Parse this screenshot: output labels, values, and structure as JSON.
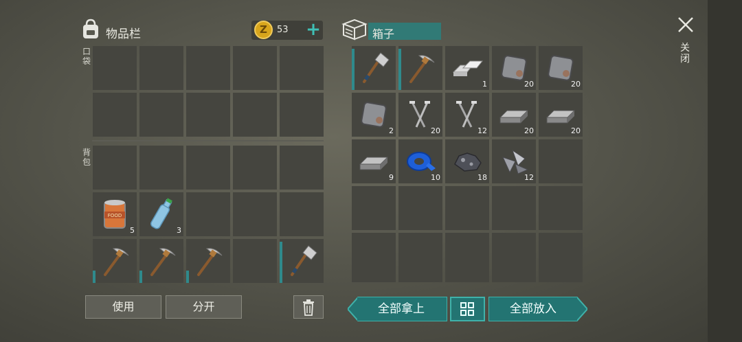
{
  "inventory": {
    "title": "物品栏",
    "coins": "53",
    "pocket_label": "口袋",
    "backpack_label": "背包",
    "pocket_items": [],
    "backpack_items": [
      {
        "slot": 5,
        "icon": "food-can-icon",
        "count": "5"
      },
      {
        "slot": 6,
        "icon": "water-bottle-icon",
        "count": "3"
      },
      {
        "slot": 10,
        "icon": "pickaxe-icon",
        "count": ""
      },
      {
        "slot": 11,
        "icon": "pickaxe-icon",
        "count": ""
      },
      {
        "slot": 12,
        "icon": "pickaxe-icon",
        "count": ""
      },
      {
        "slot": 14,
        "icon": "hatchet-icon",
        "count": ""
      }
    ],
    "use_button": "使用",
    "split_button": "分开"
  },
  "box": {
    "title": "箱子",
    "items": [
      {
        "slot": 0,
        "icon": "hatchet-icon",
        "count": ""
      },
      {
        "slot": 1,
        "icon": "pickaxe-icon",
        "count": ""
      },
      {
        "slot": 2,
        "icon": "aluminum-ingot-icon",
        "count": "1"
      },
      {
        "slot": 3,
        "icon": "iron-plate-icon",
        "count": "20"
      },
      {
        "slot": 4,
        "icon": "iron-plate-icon",
        "count": "20"
      },
      {
        "slot": 5,
        "icon": "iron-plate-icon",
        "count": "2"
      },
      {
        "slot": 6,
        "icon": "nails-icon",
        "count": "20"
      },
      {
        "slot": 7,
        "icon": "nails-icon",
        "count": "12"
      },
      {
        "slot": 8,
        "icon": "iron-bar-icon",
        "count": "20"
      },
      {
        "slot": 9,
        "icon": "iron-bar-icon",
        "count": "20"
      },
      {
        "slot": 10,
        "icon": "iron-bar-icon",
        "count": "9"
      },
      {
        "slot": 11,
        "icon": "tape-icon",
        "count": "10"
      },
      {
        "slot": 12,
        "icon": "iron-ore-icon",
        "count": "18"
      },
      {
        "slot": 13,
        "icon": "scrap-metal-icon",
        "count": "12"
      }
    ],
    "take_all_button": "全部拿上",
    "put_all_button": "全部放入"
  },
  "close_label": "关闭",
  "colors": {
    "accent": "#2f8a8c",
    "teal_button": "#237472",
    "coin": "#d8a51c"
  }
}
